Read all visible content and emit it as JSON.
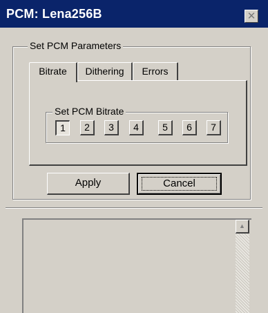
{
  "window": {
    "title": "PCM: Lena256B",
    "close_icon": "close-icon"
  },
  "params_group": {
    "legend": "Set PCM Parameters"
  },
  "tabs": [
    {
      "label": "Bitrate",
      "active": true
    },
    {
      "label": "Dithering",
      "active": false
    },
    {
      "label": "Errors",
      "active": false
    }
  ],
  "bitrate_group": {
    "legend": "Set PCM Bitrate",
    "buttons": [
      "1",
      "2",
      "3",
      "4",
      "5",
      "6",
      "7"
    ],
    "selected": "1"
  },
  "actions": {
    "apply_label": "Apply",
    "cancel_label": "Cancel"
  },
  "scrollbar": {
    "up_icon": "arrow-up-icon"
  }
}
